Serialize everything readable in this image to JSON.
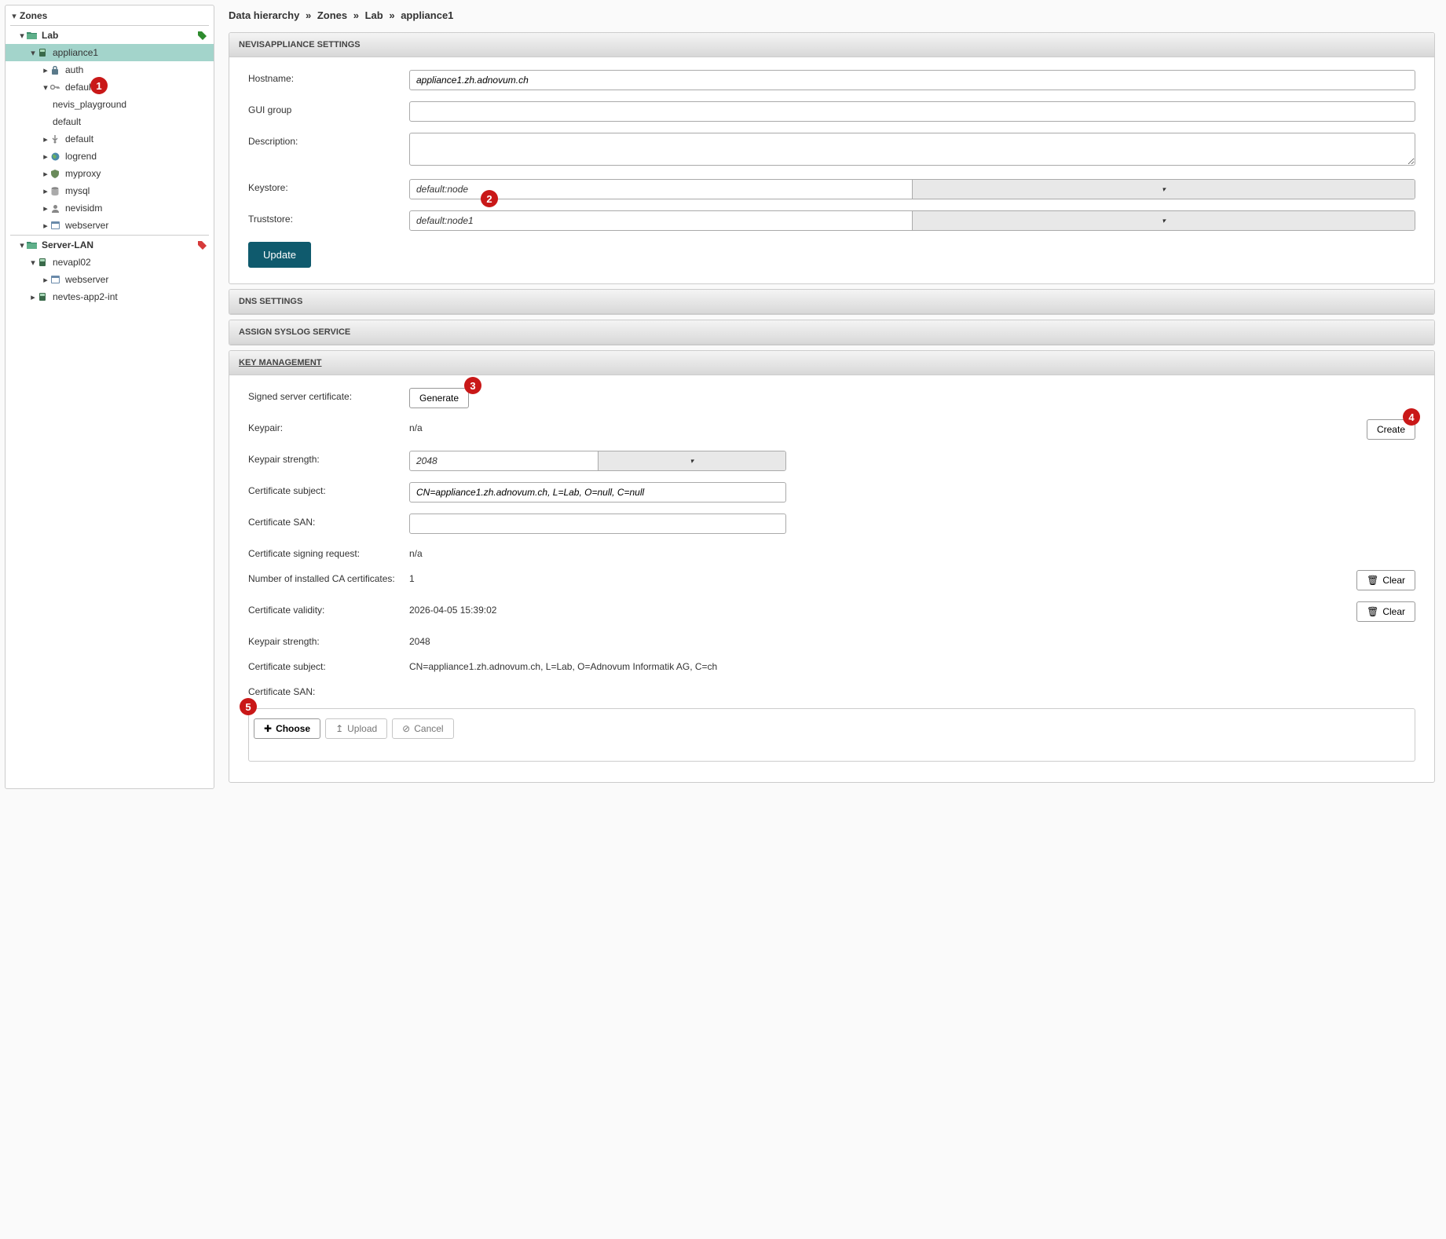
{
  "breadcrumb": {
    "root": "Data hierarchy",
    "zones": "Zones",
    "lab": "Lab",
    "node": "appliance1"
  },
  "tree": {
    "zones": "Zones",
    "lab": "Lab",
    "appliance1": "appliance1",
    "auth": "auth",
    "default": "default",
    "nevis_playground": "nevis_playground",
    "default2": "default",
    "default3": "default",
    "logrend": "logrend",
    "myproxy": "myproxy",
    "mysql": "mysql",
    "nevisidm": "nevisidm",
    "webserver": "webserver",
    "serverlan": "Server-LAN",
    "nevapl02": "nevapl02",
    "webserver2": "webserver",
    "nevtes": "nevtes-app2-int"
  },
  "sections": {
    "appliance": "NEVISAPPLIANCE SETTINGS",
    "dns": "DNS SETTINGS",
    "syslog": "ASSIGN SYSLOG SERVICE",
    "keymgmt": "KEY MANAGEMENT"
  },
  "appliance": {
    "labels": {
      "hostname": "Hostname:",
      "gui": "GUI group",
      "desc": "Description:",
      "keystore": "Keystore:",
      "truststore": "Truststore:"
    },
    "hostname": "appliance1.zh.adnovum.ch",
    "gui_group": "",
    "description": "",
    "keystore": "default:node",
    "truststore": "default:node1",
    "update": "Update"
  },
  "key": {
    "labels": {
      "signed": "Signed server certificate:",
      "keypair": "Keypair:",
      "strength": "Keypair strength:",
      "subject": "Certificate subject:",
      "san": "Certificate SAN:",
      "csr": "Certificate signing request:",
      "numca": "Number of installed CA certificates:",
      "validity": "Certificate validity:",
      "strength2": "Keypair strength:",
      "subject2": "Certificate subject:",
      "san2": "Certificate SAN:"
    },
    "generate": "Generate",
    "create": "Create",
    "keypair": "n/a",
    "strength_sel": "2048",
    "subject_val": "CN=appliance1.zh.adnovum.ch, L=Lab, O=null, C=null",
    "san_val": "",
    "csr": "n/a",
    "numca": "1",
    "validity": "2026-04-05 15:39:02",
    "strength2": "2048",
    "subject2": "CN=appliance1.zh.adnovum.ch, L=Lab, O=Adnovum Informatik AG, C=ch",
    "san2": "",
    "clear": "Clear",
    "choose": "Choose",
    "upload": "Upload",
    "cancel": "Cancel"
  },
  "callouts": {
    "c1": "1",
    "c2": "2",
    "c3": "3",
    "c4": "4",
    "c5": "5"
  }
}
